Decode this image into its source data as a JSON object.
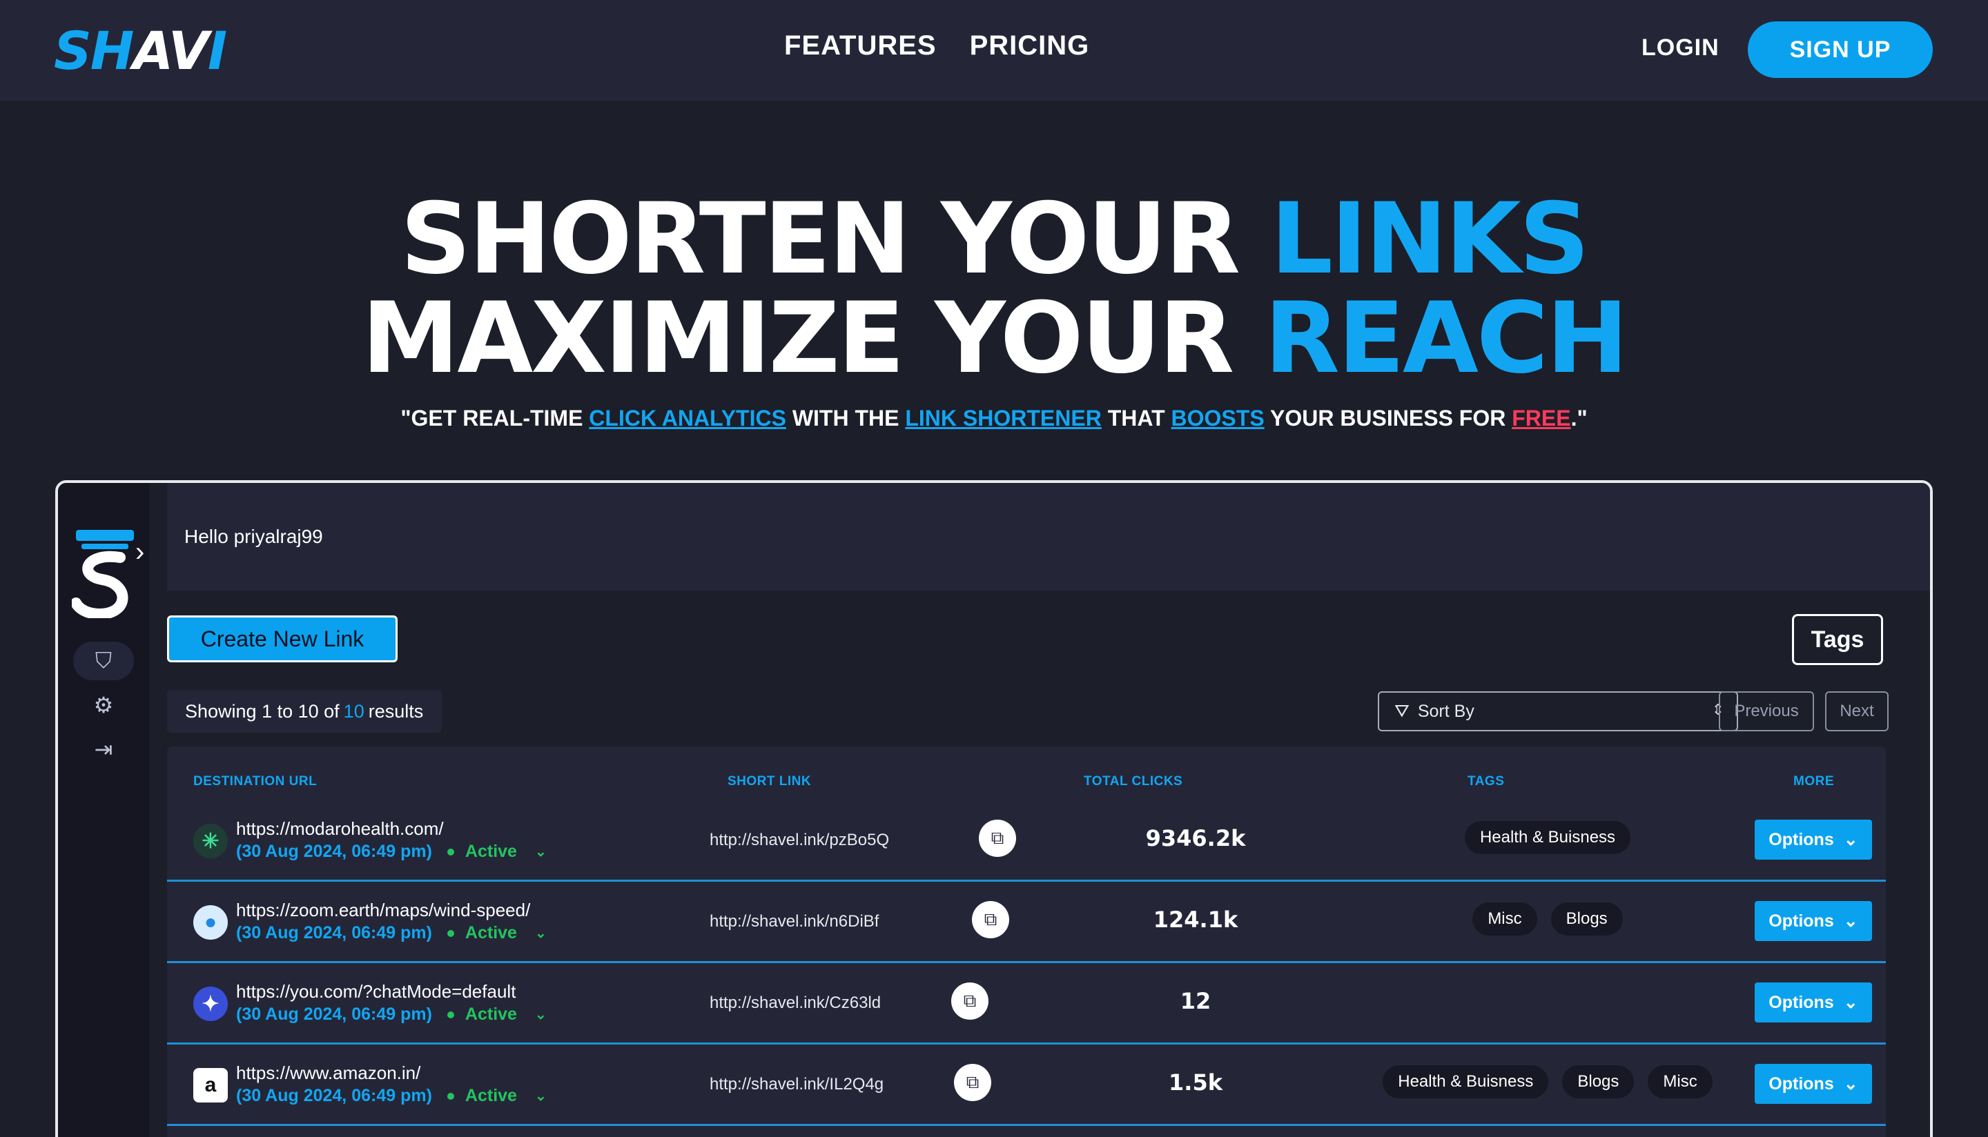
{
  "nav": {
    "logo": {
      "part1": "SH",
      "part2": "AV",
      "part3": "I"
    },
    "links": [
      "FEATURES",
      "PRICING"
    ],
    "login": "LOGIN",
    "signup": "SIGN UP"
  },
  "hero": {
    "line1_a": "SHORTEN YOUR ",
    "line1_b": "LINKS",
    "line2_a": "MAXIMIZE YOUR ",
    "line2_b": "REACH",
    "tagline": {
      "t1": "\"GET REAL-TIME ",
      "l1": "CLICK ANALYTICS",
      "t2": " WITH THE ",
      "l2": "LINK SHORTENER",
      "t3": " THAT ",
      "l3": "BOOSTS",
      "t4": " YOUR BUSINESS FOR ",
      "l4": "FREE",
      "t5": ".\""
    }
  },
  "app": {
    "greeting": "Hello priyalraj99",
    "create_button": "Create New Link",
    "tags_button": "Tags",
    "showing": {
      "prefix": "Showing 1 to 10 of",
      "total": "10",
      "suffix": "results"
    },
    "sort_label": "Sort By",
    "prev": "Previous",
    "next": "Next",
    "columns": [
      "DESTINATION URL",
      "SHORT LINK",
      "TOTAL CLICKS",
      "TAGS",
      "MORE"
    ],
    "rows": [
      {
        "url": "https://modarohealth.com/",
        "date": "(30 Aug 2024, 06:49 pm)",
        "status": "Active",
        "short": "http://shavel.ink/pzBo5Q",
        "clicks": "9346.2k",
        "tags": [
          "Health & Buisness"
        ],
        "options": "Options"
      },
      {
        "url": "https://zoom.earth/maps/wind-speed/",
        "date": "(30 Aug 2024, 06:49 pm)",
        "status": "Active",
        "short": "http://shavel.ink/n6DiBf",
        "clicks": "124.1k",
        "tags": [
          "Misc",
          "Blogs"
        ],
        "options": "Options"
      },
      {
        "url": "https://you.com/?chatMode=default",
        "date": "(30 Aug 2024, 06:49 pm)",
        "status": "Active",
        "short": "http://shavel.ink/Cz63ld",
        "clicks": "12",
        "tags": [],
        "options": "Options"
      },
      {
        "url": "https://www.amazon.in/",
        "date": "(30 Aug 2024, 06:49 pm)",
        "status": "Active",
        "short": "http://shavel.ink/IL2Q4g",
        "clicks": "1.5k",
        "tags": [
          "Health & Buisness",
          "Blogs",
          "Misc"
        ],
        "options": "Options"
      }
    ]
  },
  "favicons": [
    {
      "icon": "medical-star-icon",
      "glyph": "✳",
      "bg": "#1f3d35",
      "fg": "#3ddc97"
    },
    {
      "icon": "earth-icon",
      "glyph": "●",
      "bg": "#d8ecff",
      "fg": "#1e88e5"
    },
    {
      "icon": "sparkle-icon",
      "glyph": "✦",
      "bg": "#3a4fd8",
      "fg": "#ffffff"
    },
    {
      "icon": "amazon-icon",
      "glyph": "a",
      "bg": "#ffffff",
      "fg": "#111111"
    }
  ],
  "colors": {
    "accent": "#12a6f2",
    "active": "#22c55e",
    "free": "#ff3b5c",
    "button": "#0aa2ee"
  }
}
